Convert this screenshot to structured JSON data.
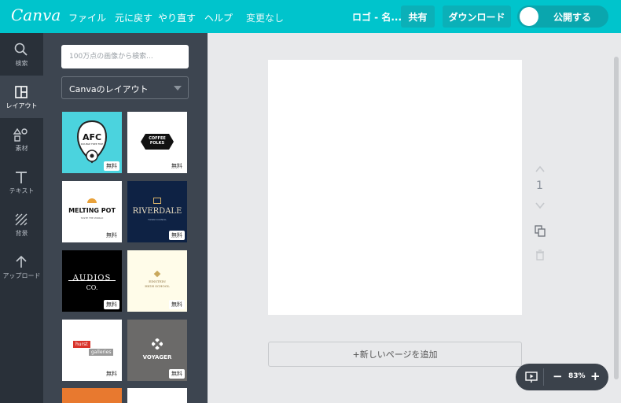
{
  "topbar": {
    "logo": "Canva",
    "menu": [
      "ファイル",
      "元に戻す",
      "やり直す",
      "ヘルプ"
    ],
    "save_status": "変更なし",
    "doc_title": "ロゴ - 名...",
    "share_label": "共有",
    "download_label": "ダウンロード",
    "publish_label": "公開する"
  },
  "rail": {
    "items": [
      {
        "label": "検索",
        "icon": "search-icon"
      },
      {
        "label": "レイアウト",
        "icon": "layout-icon"
      },
      {
        "label": "素材",
        "icon": "elements-icon"
      },
      {
        "label": "テキスト",
        "icon": "text-icon"
      },
      {
        "label": "背景",
        "icon": "background-icon"
      },
      {
        "label": "アップロード",
        "icon": "upload-icon"
      }
    ]
  },
  "panel": {
    "search_placeholder": "100万点の画像から検索...",
    "layout_select": "Canvaのレイアウト",
    "free_badge": "無料",
    "templates": [
      {
        "title": "AFC",
        "subtitle": "DOUBLE FREE FIRE"
      },
      {
        "title": "COFFEE FOLKS"
      },
      {
        "title": "MELTING POT",
        "subtitle": "TASTE THE WORLD"
      },
      {
        "title": "RIVERDALE",
        "subtitle": "TOWN COUNCIL"
      },
      {
        "title": "AUDIOS",
        "subtitle": "CO."
      },
      {
        "title": "EINSTEIN",
        "subtitle": "HIGH SCHOOL"
      },
      {
        "title": "hurst",
        "subtitle": "galleries"
      },
      {
        "title": "VOYAGER"
      }
    ]
  },
  "editor": {
    "page_number": "1",
    "add_page_label": "+新しいページを追加"
  },
  "zoom": {
    "level": "83%",
    "minus": "−",
    "plus": "+"
  },
  "colors": {
    "brand": "#00c4cc",
    "rail": "#293039",
    "panel": "#3d4550"
  }
}
